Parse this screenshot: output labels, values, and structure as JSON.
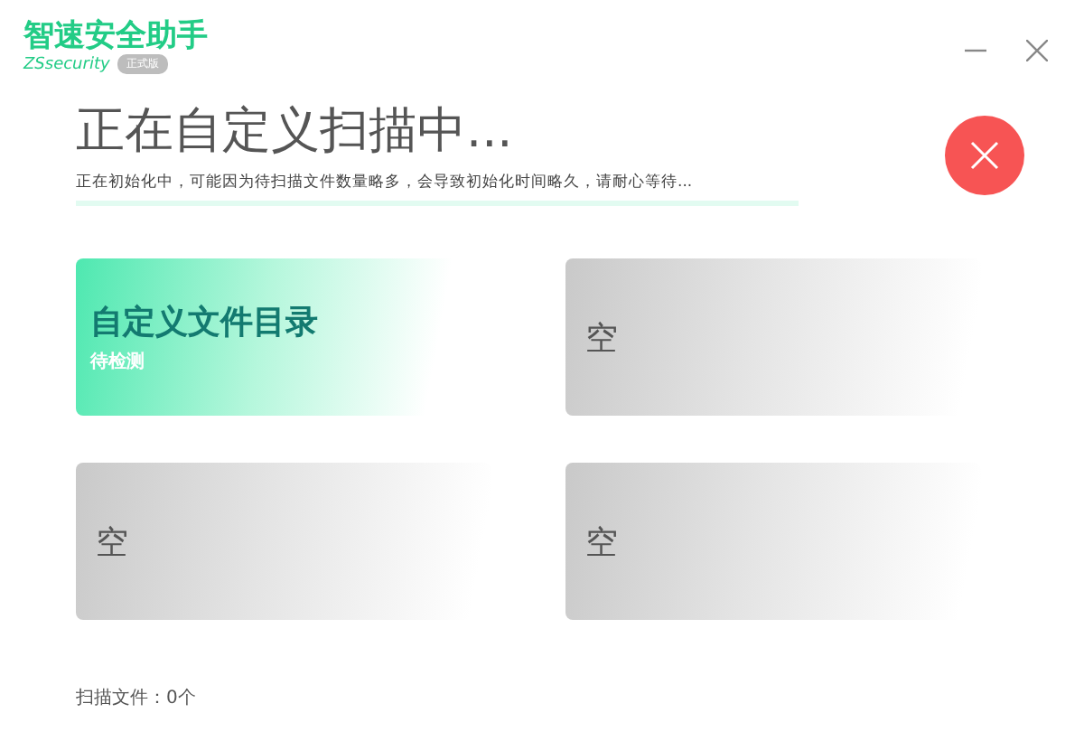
{
  "app": {
    "name": "智速安全助手",
    "subtitle": "ZSsecurity",
    "badge": "正式版"
  },
  "window_controls": [
    {
      "kind": "minimize"
    },
    {
      "kind": "close"
    }
  ],
  "scan": {
    "title": "正在自定义扫描中...",
    "message": "正在初始化中，可能因为待扫描文件数量略多，会导致初始化时间略久，请耐心等待..."
  },
  "cards": [
    {
      "kind": "task",
      "title": "自定义文件目录",
      "status": "待检测"
    },
    {
      "kind": "empty",
      "title": "空"
    },
    {
      "kind": "empty",
      "title": "空"
    },
    {
      "kind": "empty",
      "title": "空"
    }
  ],
  "footer": {
    "scanned_files": "扫描文件：0个"
  }
}
